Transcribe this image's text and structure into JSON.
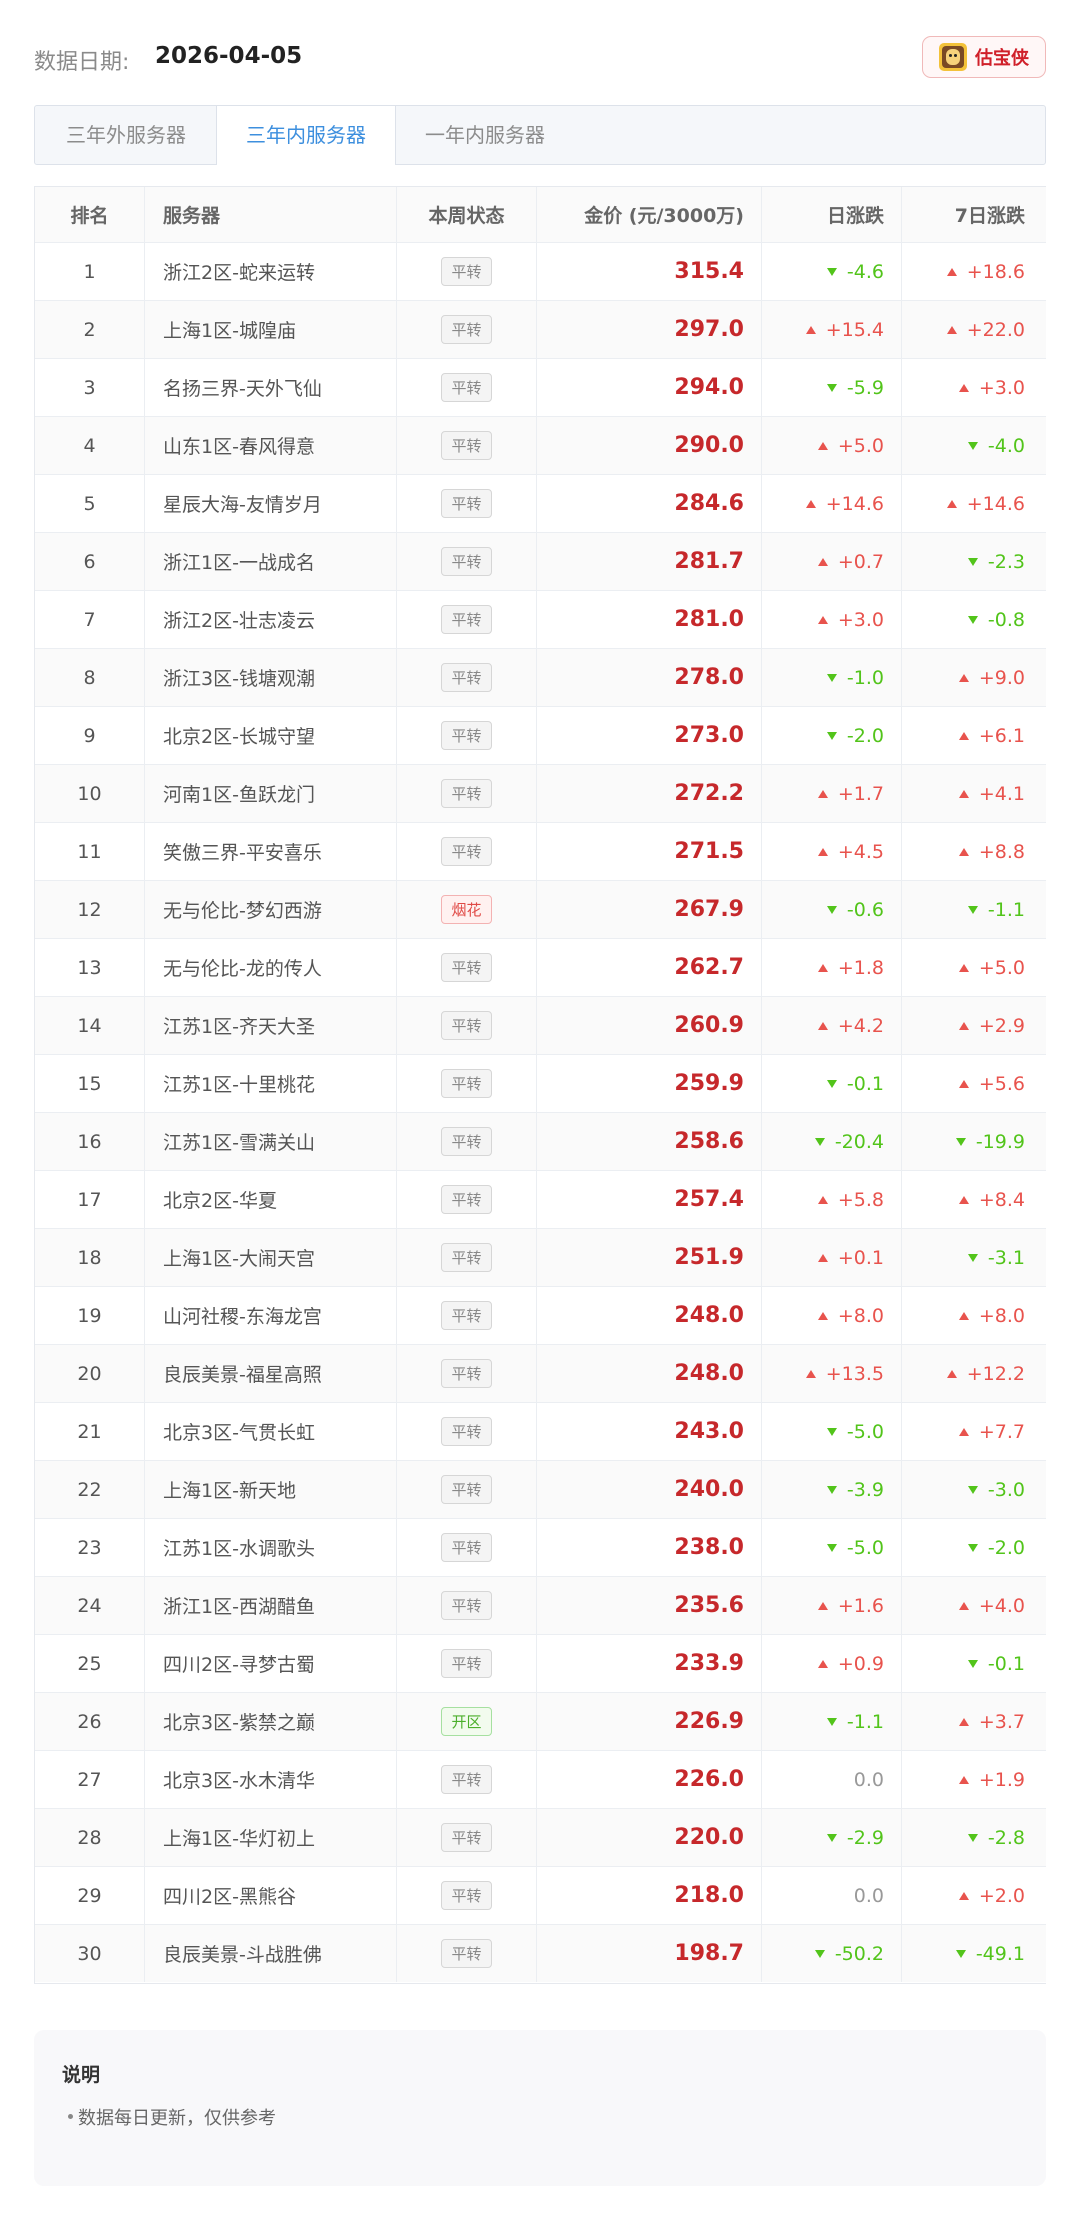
{
  "header": {
    "date_label": "数据日期:",
    "date_value": "2026-04-05",
    "brand_name": "估宝侠"
  },
  "tabs": [
    {
      "label": "三年外服务器",
      "active": false
    },
    {
      "label": "三年内服务器",
      "active": true
    },
    {
      "label": "一年内服务器",
      "active": false
    }
  ],
  "table": {
    "columns": [
      "排名",
      "服务器",
      "本周状态",
      "金价 (元/3000万)",
      "日涨跌",
      "7日涨跌"
    ],
    "rows": [
      {
        "rank": "1",
        "server": "浙江2区-蛇来运转",
        "status": "平转",
        "price": "315.4",
        "day": "-4.6",
        "week": "+18.6"
      },
      {
        "rank": "2",
        "server": "上海1区-城隍庙",
        "status": "平转",
        "price": "297.0",
        "day": "+15.4",
        "week": "+22.0"
      },
      {
        "rank": "3",
        "server": "名扬三界-天外飞仙",
        "status": "平转",
        "price": "294.0",
        "day": "-5.9",
        "week": "+3.0"
      },
      {
        "rank": "4",
        "server": "山东1区-春风得意",
        "status": "平转",
        "price": "290.0",
        "day": "+5.0",
        "week": "-4.0"
      },
      {
        "rank": "5",
        "server": "星辰大海-友情岁月",
        "status": "平转",
        "price": "284.6",
        "day": "+14.6",
        "week": "+14.6"
      },
      {
        "rank": "6",
        "server": "浙江1区-一战成名",
        "status": "平转",
        "price": "281.7",
        "day": "+0.7",
        "week": "-2.3"
      },
      {
        "rank": "7",
        "server": "浙江2区-壮志凌云",
        "status": "平转",
        "price": "281.0",
        "day": "+3.0",
        "week": "-0.8"
      },
      {
        "rank": "8",
        "server": "浙江3区-钱塘观潮",
        "status": "平转",
        "price": "278.0",
        "day": "-1.0",
        "week": "+9.0"
      },
      {
        "rank": "9",
        "server": "北京2区-长城守望",
        "status": "平转",
        "price": "273.0",
        "day": "-2.0",
        "week": "+6.1"
      },
      {
        "rank": "10",
        "server": "河南1区-鱼跃龙门",
        "status": "平转",
        "price": "272.2",
        "day": "+1.7",
        "week": "+4.1"
      },
      {
        "rank": "11",
        "server": "笑傲三界-平安喜乐",
        "status": "平转",
        "price": "271.5",
        "day": "+4.5",
        "week": "+8.8"
      },
      {
        "rank": "12",
        "server": "无与伦比-梦幻西游",
        "status": "烟花",
        "price": "267.9",
        "day": "-0.6",
        "week": "-1.1"
      },
      {
        "rank": "13",
        "server": "无与伦比-龙的传人",
        "status": "平转",
        "price": "262.7",
        "day": "+1.8",
        "week": "+5.0"
      },
      {
        "rank": "14",
        "server": "江苏1区-齐天大圣",
        "status": "平转",
        "price": "260.9",
        "day": "+4.2",
        "week": "+2.9"
      },
      {
        "rank": "15",
        "server": "江苏1区-十里桃花",
        "status": "平转",
        "price": "259.9",
        "day": "-0.1",
        "week": "+5.6"
      },
      {
        "rank": "16",
        "server": "江苏1区-雪满关山",
        "status": "平转",
        "price": "258.6",
        "day": "-20.4",
        "week": "-19.9"
      },
      {
        "rank": "17",
        "server": "北京2区-华夏",
        "status": "平转",
        "price": "257.4",
        "day": "+5.8",
        "week": "+8.4"
      },
      {
        "rank": "18",
        "server": "上海1区-大闹天宫",
        "status": "平转",
        "price": "251.9",
        "day": "+0.1",
        "week": "-3.1"
      },
      {
        "rank": "19",
        "server": "山河社稷-东海龙宫",
        "status": "平转",
        "price": "248.0",
        "day": "+8.0",
        "week": "+8.0"
      },
      {
        "rank": "20",
        "server": "良辰美景-福星高照",
        "status": "平转",
        "price": "248.0",
        "day": "+13.5",
        "week": "+12.2"
      },
      {
        "rank": "21",
        "server": "北京3区-气贯长虹",
        "status": "平转",
        "price": "243.0",
        "day": "-5.0",
        "week": "+7.7"
      },
      {
        "rank": "22",
        "server": "上海1区-新天地",
        "status": "平转",
        "price": "240.0",
        "day": "-3.9",
        "week": "-3.0"
      },
      {
        "rank": "23",
        "server": "江苏1区-水调歌头",
        "status": "平转",
        "price": "238.0",
        "day": "-5.0",
        "week": "-2.0"
      },
      {
        "rank": "24",
        "server": "浙江1区-西湖醋鱼",
        "status": "平转",
        "price": "235.6",
        "day": "+1.6",
        "week": "+4.0"
      },
      {
        "rank": "25",
        "server": "四川2区-寻梦古蜀",
        "status": "平转",
        "price": "233.9",
        "day": "+0.9",
        "week": "-0.1"
      },
      {
        "rank": "26",
        "server": "北京3区-紫禁之巅",
        "status": "开区",
        "price": "226.9",
        "day": "-1.1",
        "week": "+3.7"
      },
      {
        "rank": "27",
        "server": "北京3区-水木清华",
        "status": "平转",
        "price": "226.0",
        "day": "0.0",
        "week": "+1.9"
      },
      {
        "rank": "28",
        "server": "上海1区-华灯初上",
        "status": "平转",
        "price": "220.0",
        "day": "-2.9",
        "week": "-2.8"
      },
      {
        "rank": "29",
        "server": "四川2区-黑熊谷",
        "status": "平转",
        "price": "218.0",
        "day": "0.0",
        "week": "+2.0"
      },
      {
        "rank": "30",
        "server": "良辰美景-斗战胜佛",
        "status": "平转",
        "price": "198.7",
        "day": "-50.2",
        "week": "-49.1"
      }
    ]
  },
  "notes": {
    "title": "说明",
    "items": [
      "数据每日更新，仅供参考"
    ]
  },
  "colors": {
    "price": "#c6282b",
    "up": "#e8534d",
    "down": "#52c41a",
    "flat": "#999999",
    "tab_active": "#3d8fde"
  }
}
